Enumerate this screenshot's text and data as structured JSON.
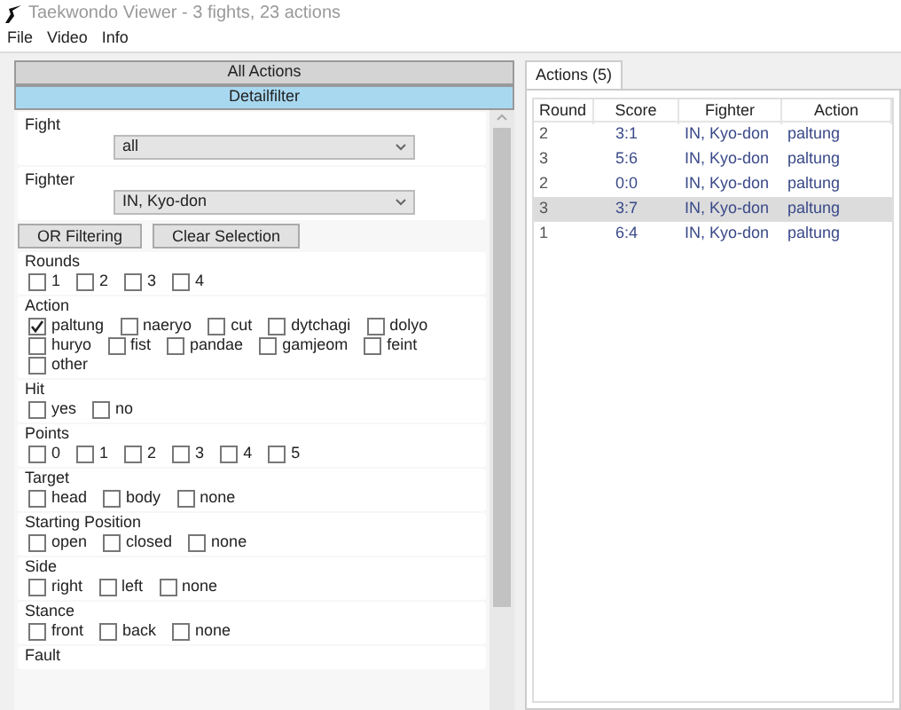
{
  "window": {
    "title": "Taekwondo Viewer - 3 fights, 23 actions"
  },
  "menu": [
    "File",
    "Video",
    "Info"
  ],
  "accordion": [
    {
      "label": "All Actions",
      "selected": false
    },
    {
      "label": "Detailfilter",
      "selected": true
    }
  ],
  "dropdowns": [
    {
      "label": "Fight",
      "value": "all"
    },
    {
      "label": "Fighter",
      "value": "IN, Kyo-don"
    }
  ],
  "buttons": [
    "OR Filtering",
    "Clear Selection"
  ],
  "groups": [
    {
      "label": "Rounds",
      "options": [
        {
          "label": "1",
          "checked": false
        },
        {
          "label": "2",
          "checked": false
        },
        {
          "label": "3",
          "checked": false
        },
        {
          "label": "4",
          "checked": false
        }
      ]
    },
    {
      "label": "Action",
      "options": [
        {
          "label": "paltung",
          "checked": true
        },
        {
          "label": "naeryo",
          "checked": false
        },
        {
          "label": "cut",
          "checked": false
        },
        {
          "label": "dytchagi",
          "checked": false
        },
        {
          "label": "dolyo",
          "checked": false
        },
        {
          "label": "huryo",
          "checked": false
        },
        {
          "label": "fist",
          "checked": false
        },
        {
          "label": "pandae",
          "checked": false
        },
        {
          "label": "gamjeom",
          "checked": false
        },
        {
          "label": "feint",
          "checked": false
        },
        {
          "label": "other",
          "checked": false
        }
      ]
    },
    {
      "label": "Hit",
      "options": [
        {
          "label": "yes",
          "checked": false
        },
        {
          "label": "no",
          "checked": false
        }
      ]
    },
    {
      "label": "Points",
      "options": [
        {
          "label": "0",
          "checked": false
        },
        {
          "label": "1",
          "checked": false
        },
        {
          "label": "2",
          "checked": false
        },
        {
          "label": "3",
          "checked": false
        },
        {
          "label": "4",
          "checked": false
        },
        {
          "label": "5",
          "checked": false
        }
      ]
    },
    {
      "label": "Target",
      "options": [
        {
          "label": "head",
          "checked": false
        },
        {
          "label": "body",
          "checked": false
        },
        {
          "label": "none",
          "checked": false
        }
      ]
    },
    {
      "label": "Starting Position",
      "options": [
        {
          "label": "open",
          "checked": false
        },
        {
          "label": "closed",
          "checked": false
        },
        {
          "label": "none",
          "checked": false
        }
      ]
    },
    {
      "label": "Side",
      "options": [
        {
          "label": "right",
          "checked": false
        },
        {
          "label": "left",
          "checked": false
        },
        {
          "label": "none",
          "checked": false
        }
      ]
    },
    {
      "label": "Stance",
      "options": [
        {
          "label": "front",
          "checked": false
        },
        {
          "label": "back",
          "checked": false
        },
        {
          "label": "none",
          "checked": false
        }
      ]
    },
    {
      "label": "Fault"
    }
  ],
  "tabs": [
    {
      "label": "Actions (5)",
      "selected": true
    }
  ],
  "table": {
    "columns": [
      "Round",
      "Score",
      "Fighter",
      "Action"
    ],
    "rows": [
      {
        "cells": [
          "2",
          "3:1",
          "IN, Kyo-don",
          "paltung"
        ],
        "selected": false
      },
      {
        "cells": [
          "3",
          "5:6",
          "IN, Kyo-don",
          "paltung"
        ],
        "selected": false
      },
      {
        "cells": [
          "2",
          "0:0",
          "IN, Kyo-don",
          "paltung"
        ],
        "selected": false
      },
      {
        "cells": [
          "3",
          "3:7",
          "IN, Kyo-don",
          "paltung"
        ],
        "selected": true
      },
      {
        "cells": [
          "1",
          "6:4",
          "IN, Kyo-don",
          "paltung"
        ],
        "selected": false
      }
    ]
  }
}
